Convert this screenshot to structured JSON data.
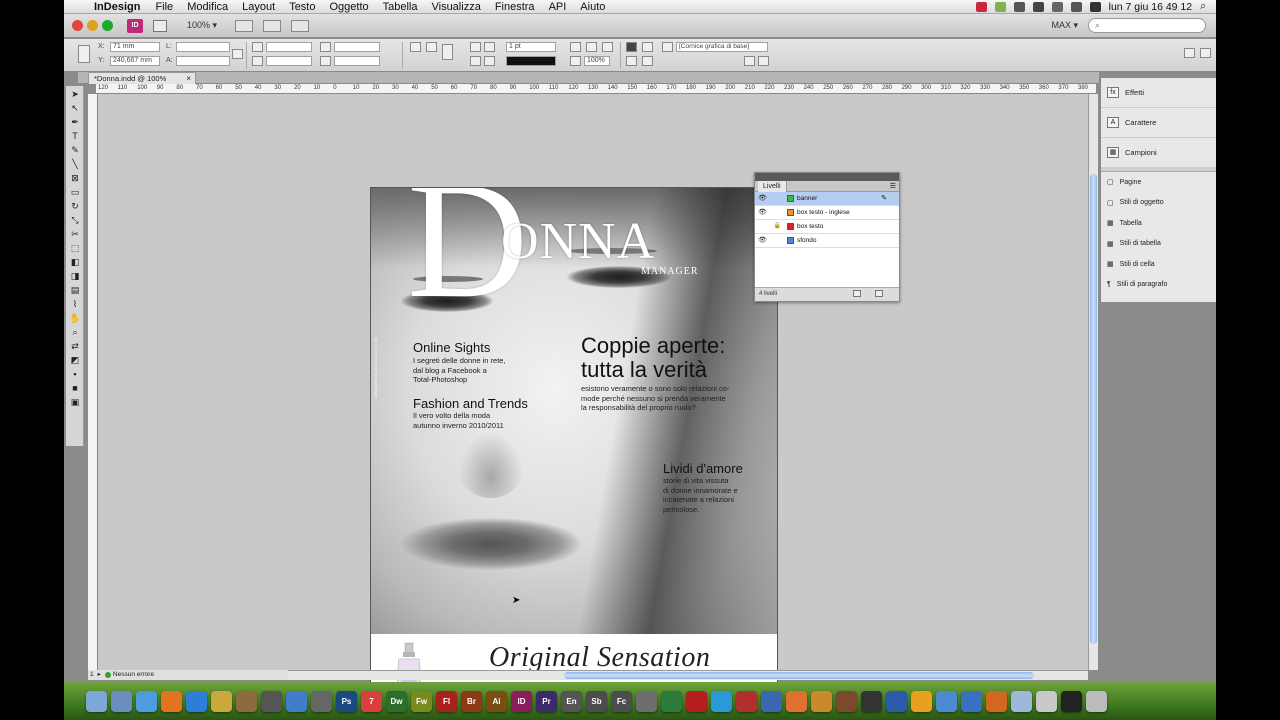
{
  "menubar": {
    "app": "InDesign",
    "items": [
      "File",
      "Modifica",
      "Layout",
      "Testo",
      "Oggetto",
      "Tabella",
      "Visualizza",
      "Finestra",
      "API",
      "Aiuto"
    ],
    "clock": "lun 7 giu  16 49 12"
  },
  "appbar": {
    "badge": "ID",
    "zoom": "100%",
    "workspace": "MAX",
    "search_placeholder": ""
  },
  "control": {
    "x_label": "X:",
    "x_value": "71 mm",
    "y_label": "Y:",
    "y_value": "240,667 mm",
    "l_label": "L:",
    "a_label": "A:",
    "stroke_weight": "1 pt",
    "opacity": "100%",
    "object_style": "[Cornice grafica di base]"
  },
  "document": {
    "tab_title": "*Donna.indd @ 100%",
    "tab_close": "×"
  },
  "ruler": {
    "labels": [
      "120",
      "110",
      "100",
      "90",
      "80",
      "70",
      "60",
      "50",
      "40",
      "30",
      "20",
      "10",
      "0",
      "10",
      "20",
      "30",
      "40",
      "50",
      "60",
      "70",
      "80",
      "90",
      "100",
      "110",
      "120",
      "130",
      "140",
      "150",
      "160",
      "170",
      "180",
      "190",
      "200",
      "210",
      "220",
      "230",
      "240",
      "250",
      "260",
      "270",
      "280",
      "290",
      "300",
      "310",
      "320",
      "330",
      "340",
      "350",
      "360",
      "370",
      "380"
    ]
  },
  "cover": {
    "logo_D": "D",
    "logo_rest": "ONNA",
    "logo_sub": "MANAGER",
    "spine_text": "www.donna.it  |  anno 1  n.1  |  € 3,00",
    "online_title": "Online Sights",
    "online_body": [
      "I segreti delle donne in rete,",
      "dal blog a Facebook a",
      "Total-Photoshop"
    ],
    "fashion_title": "Fashion and Trends",
    "fashion_body": [
      "Il vero volto della moda",
      "autunno inverno 2010/2011"
    ],
    "coppie_title": [
      "Coppie aperte:",
      "tutta la verità"
    ],
    "coppie_body": [
      "esistono veramente o sono solo relazioni co-",
      "mode perché nessuno si prenda veramente",
      "la responsabilità del proprio ruolo?"
    ],
    "lividi_title": "Lividi d'amore",
    "lividi_body": [
      "storie di vita vissuta",
      "di donne innamorate e",
      "incatenate a relazioni",
      "pericolose."
    ],
    "banner_text": "Original Sensation"
  },
  "layers_panel": {
    "tab": "Livelli",
    "rows": [
      {
        "name": "banner",
        "color": "#3dbb4a",
        "selected": true,
        "visible": true,
        "locked": false
      },
      {
        "name": "box testo - inglese",
        "color": "#f0922b",
        "selected": false,
        "visible": true,
        "locked": false
      },
      {
        "name": "box testo",
        "color": "#d2232a",
        "selected": false,
        "visible": false,
        "locked": true
      },
      {
        "name": "sfondo",
        "color": "#4f86d9",
        "selected": false,
        "visible": true,
        "locked": false
      }
    ],
    "footer": "4 livelli"
  },
  "dock_panels": {
    "main": [
      {
        "icon": "fx",
        "label": "Effetti"
      },
      {
        "icon": "A",
        "label": "Carattere"
      },
      {
        "icon": "▦",
        "label": "Campioni"
      }
    ],
    "sub": [
      {
        "icon": "▢",
        "label": "Pagine"
      },
      {
        "icon": "▢",
        "label": "Stili di oggetto"
      },
      {
        "icon": "▦",
        "label": "Tabella"
      },
      {
        "icon": "▦",
        "label": "Stili di tabella"
      },
      {
        "icon": "▦",
        "label": "Stili di cella"
      },
      {
        "icon": "¶",
        "label": "Stili di paragrafo"
      }
    ]
  },
  "status": {
    "page": "1",
    "preflight": "Nessun errore"
  },
  "os_dock": {
    "apps": [
      {
        "label": "",
        "color": "#7aa8d8"
      },
      {
        "label": "",
        "color": "#6a8fbf"
      },
      {
        "label": "",
        "color": "#4f9be0"
      },
      {
        "label": "",
        "color": "#e2731f"
      },
      {
        "label": "",
        "color": "#2c7ed6"
      },
      {
        "label": "",
        "color": "#c9a83c"
      },
      {
        "label": "",
        "color": "#8d6b3f"
      },
      {
        "label": "",
        "color": "#555555"
      },
      {
        "label": "",
        "color": "#3f7dc8"
      },
      {
        "label": "",
        "color": "#666666"
      },
      {
        "label": "Ps",
        "color": "#1c4a80"
      },
      {
        "label": "7",
        "color": "#d84040"
      },
      {
        "label": "Dw",
        "color": "#2f6d2a"
      },
      {
        "label": "Fw",
        "color": "#7a8b1e"
      },
      {
        "label": "Fl",
        "color": "#a8221c"
      },
      {
        "label": "Br",
        "color": "#8d3a16"
      },
      {
        "label": "Ai",
        "color": "#7a4d12"
      },
      {
        "label": "ID",
        "color": "#8a1d5c"
      },
      {
        "label": "Pr",
        "color": "#3d2a6b"
      },
      {
        "label": "En",
        "color": "#555555"
      },
      {
        "label": "Sb",
        "color": "#4d4d4d"
      },
      {
        "label": "Fc",
        "color": "#4d4d4d"
      },
      {
        "label": "",
        "color": "#6d6d6d"
      },
      {
        "label": "",
        "color": "#2b7b3a"
      },
      {
        "label": "",
        "color": "#b51e1e"
      },
      {
        "label": "",
        "color": "#2a9ad6"
      },
      {
        "label": "",
        "color": "#b03030"
      },
      {
        "label": "",
        "color": "#3a68b0"
      },
      {
        "label": "",
        "color": "#e07030"
      },
      {
        "label": "",
        "color": "#c88a2a"
      },
      {
        "label": "",
        "color": "#7a4a2a"
      },
      {
        "label": "",
        "color": "#333333"
      },
      {
        "label": "",
        "color": "#2a5aa8"
      },
      {
        "label": "",
        "color": "#e8a020"
      },
      {
        "label": "",
        "color": "#4a8ad0"
      },
      {
        "label": "",
        "color": "#3a70c0"
      },
      {
        "label": "",
        "color": "#d06820"
      },
      {
        "label": "",
        "color": "#a0b8d8"
      },
      {
        "label": "",
        "color": "#c8c8c8"
      },
      {
        "label": "",
        "color": "#222222"
      },
      {
        "label": "",
        "color": "#bbbbbb"
      }
    ]
  },
  "colors": {
    "accent": "#b6cdf2",
    "id_pink": "#c0287a"
  }
}
